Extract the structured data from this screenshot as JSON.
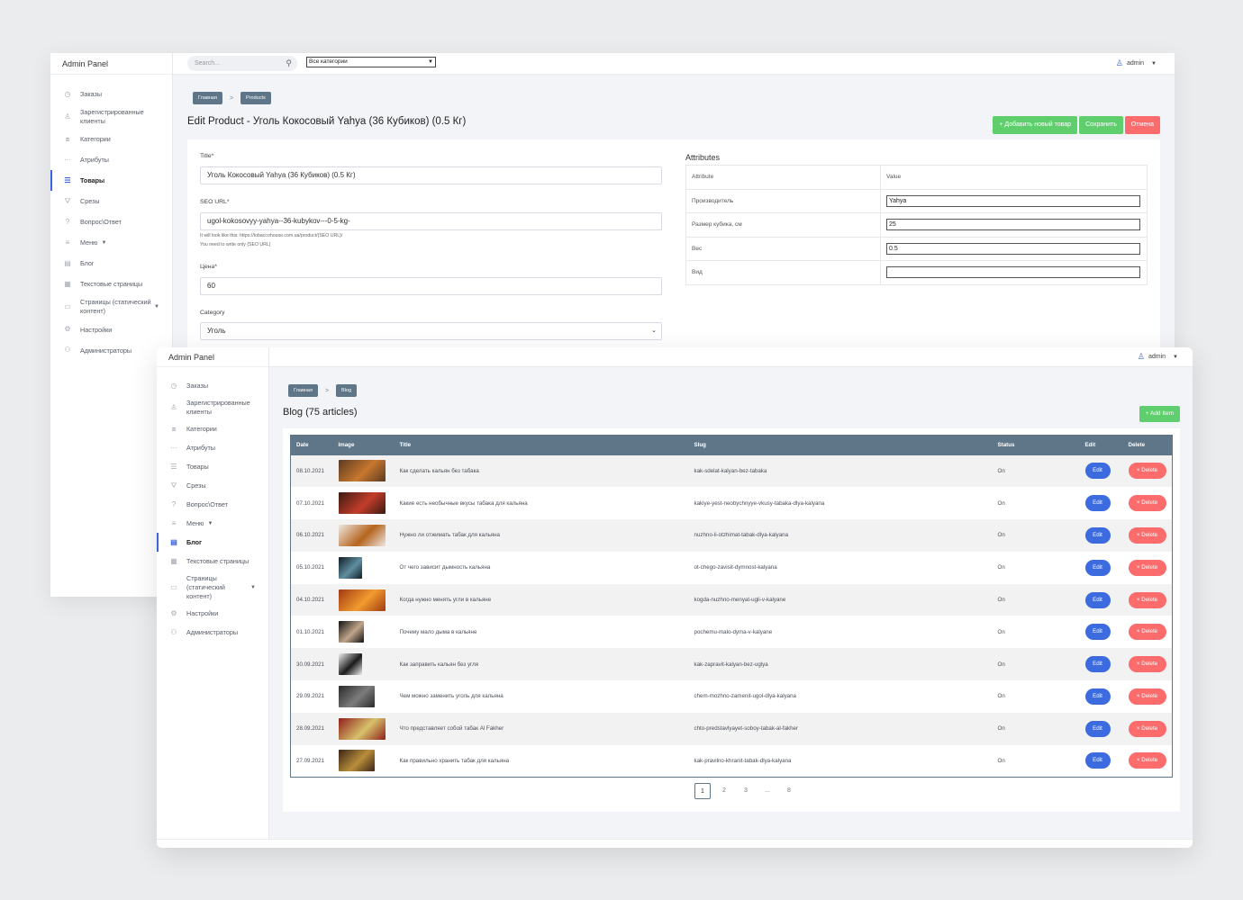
{
  "product_editor": {
    "brand": "Admin Panel",
    "search": {
      "placeholder": "Search..."
    },
    "category_filter": {
      "selected": "Все категории"
    },
    "user": "admin",
    "nav": [
      {
        "label": "Заказы",
        "icon": "clock-icon"
      },
      {
        "label": "Зарегистрированные клиенты",
        "icon": "user-icon"
      },
      {
        "label": "Категории",
        "icon": "sitemap-icon"
      },
      {
        "label": "Атрибуты",
        "icon": "dots-icon"
      },
      {
        "label": "Товары",
        "icon": "list-icon",
        "active": true
      },
      {
        "label": "Срезы",
        "icon": "filter-icon"
      },
      {
        "label": "Вопрос\\Ответ",
        "icon": "question-icon"
      },
      {
        "label": "Меню",
        "icon": "menu-icon",
        "caret": true
      },
      {
        "label": "Блог",
        "icon": "document-icon"
      },
      {
        "label": "Текстовые страницы",
        "icon": "page-icon"
      },
      {
        "label": "Страницы (статический контент)",
        "icon": "monitor-icon",
        "caret": true
      },
      {
        "label": "Настройки",
        "icon": "gear-icon"
      },
      {
        "label": "Администраторы",
        "icon": "users-icon"
      }
    ],
    "breadcrumbs": [
      "Главная",
      ">",
      "Products"
    ],
    "title": "Edit Product - Уголь Кокосовый Yahya (36 Кубиков) (0.5 Кг)",
    "actions": {
      "add_new": "+ Добавить новый товар",
      "save": "Сохранить",
      "cancel": "Отмена"
    },
    "form": {
      "title_label": "Title*",
      "title_value": "Уголь Кокосовый Yahya (36 Кубиков) (0.5 Кг)",
      "seo_label": "SEO URL*",
      "seo_value": "ugol-kokosovyy-yahya--36-kubykov---0-5-kg-",
      "seo_hint1": "It will look like this: https://tobaccohouse.com.ua/product/{SEO URL}/",
      "seo_hint2": "You need to write only {SEO URL}",
      "price_label": "Цена*",
      "price_value": "60",
      "category_label": "Category",
      "category_value": "Уголь"
    },
    "attributes": {
      "heading": "Attributes",
      "col_attribute": "Attribute",
      "col_value": "Value",
      "rows": [
        {
          "name": "Производитель",
          "value": "Yahya"
        },
        {
          "name": "Размер кубика, см",
          "value": "25"
        },
        {
          "name": "Вес",
          "value": "0.5"
        },
        {
          "name": "Вид",
          "value": ""
        }
      ]
    }
  },
  "blog_list": {
    "brand": "Admin Panel",
    "user": "admin",
    "nav": [
      {
        "label": "Заказы",
        "icon": "clock-icon"
      },
      {
        "label": "Зарегистрированные клиенты",
        "icon": "user-icon"
      },
      {
        "label": "Категории",
        "icon": "sitemap-icon"
      },
      {
        "label": "Атрибуты",
        "icon": "dots-icon"
      },
      {
        "label": "Товары",
        "icon": "list-icon"
      },
      {
        "label": "Срезы",
        "icon": "filter-icon"
      },
      {
        "label": "Вопрос\\Ответ",
        "icon": "question-icon"
      },
      {
        "label": "Меню",
        "icon": "menu-icon",
        "caret": true
      },
      {
        "label": "Блог",
        "icon": "document-icon",
        "active": true
      },
      {
        "label": "Текстовые страницы",
        "icon": "page-icon"
      },
      {
        "label": "Страницы (статический контент)",
        "icon": "monitor-icon",
        "caret": true
      },
      {
        "label": "Настройки",
        "icon": "gear-icon"
      },
      {
        "label": "Администраторы",
        "icon": "users-icon"
      }
    ],
    "breadcrumbs": [
      "Главная",
      ">",
      "Blog"
    ],
    "title": "Blog (75 articles)",
    "add_item": "+ Add Item",
    "columns": [
      "Date",
      "Image",
      "Title",
      "Slug",
      "Status",
      "Edit",
      "Delete"
    ],
    "edit_label": "Edit",
    "delete_label": "× Delete",
    "rows": [
      {
        "date": "08.10.2021",
        "title": "Как сделать кальян без табака",
        "slug": "kak-sdelat-kalyan-bez-tabaka",
        "status": "On",
        "thumb": [
          "#5a3a22",
          "#c7782e"
        ]
      },
      {
        "date": "07.10.2021",
        "title": "Какие есть необычные вкусы табака для кальяна",
        "slug": "kakiye-yest-neobychnyye-vkusy-tabaka-dlya-kalyana",
        "status": "On",
        "thumb": [
          "#3b1a12",
          "#c33d2a"
        ]
      },
      {
        "date": "06.10.2021",
        "title": "Нужно ли отжимать табак для кальяна",
        "slug": "nuzhno-li-otzhimat-tabak-dlya-kalyana",
        "status": "On",
        "thumb": [
          "#eee7e2",
          "#b5651d"
        ]
      },
      {
        "date": "05.10.2021",
        "title": "От чего зависит дымность кальяна",
        "slug": "ot-chego-zavisit-dymnost-kalyana",
        "status": "On",
        "thumb": [
          "#0f1c24",
          "#5f8ea0"
        ]
      },
      {
        "date": "04.10.2021",
        "title": "Когда нужно менять угли в кальяне",
        "slug": "kogda-nuzhno-menyat-ugli-v-kalyane",
        "status": "On",
        "thumb": [
          "#a13a12",
          "#f29b2e"
        ]
      },
      {
        "date": "01.10.2021",
        "title": "Почему мало дыма в кальяне",
        "slug": "pochemu-malo-dyma-v-kalyane",
        "status": "On",
        "thumb": [
          "#111111",
          "#bfa58a"
        ]
      },
      {
        "date": "30.09.2021",
        "title": "Как заправить кальян без угля",
        "slug": "kak-zapravit-kalyan-bez-uglya",
        "status": "On",
        "thumb": [
          "#f0f0f0",
          "#1b1b1b"
        ]
      },
      {
        "date": "29.09.2021",
        "title": "Чем можно заменить уголь для кальяна",
        "slug": "chem-mozhno-zamenit-ugol-dlya-kalyana",
        "status": "On",
        "thumb": [
          "#2a2a2a",
          "#7c7c7c"
        ]
      },
      {
        "date": "28.09.2021",
        "title": "Что представляет собой табак Al Fakher",
        "slug": "chto-predstavlyayet-soboy-tabak-al-fakher",
        "status": "On",
        "thumb": [
          "#8e1f1c",
          "#d7c16b"
        ]
      },
      {
        "date": "27.09.2021",
        "title": "Как правильно хранить табак для кальяна",
        "slug": "kak-pravilno-khranit-tabak-dlya-kalyana",
        "status": "On",
        "thumb": [
          "#3a2417",
          "#b98d3a"
        ]
      }
    ],
    "pagination": [
      "1",
      "2",
      "3",
      "...",
      "8"
    ]
  }
}
